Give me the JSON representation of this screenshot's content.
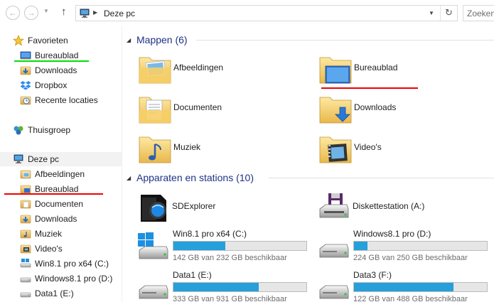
{
  "address": {
    "back_glyph": "←",
    "forward_glyph": "→",
    "up_glyph": "↑",
    "path": "Deze pc",
    "refresh_glyph": "↻",
    "search_placeholder": "Zoeken"
  },
  "nav": {
    "favorites": {
      "label": "Favorieten",
      "items": [
        {
          "label": "Bureaublad",
          "icon": "desktop-icon"
        },
        {
          "label": "Downloads",
          "icon": "downloads-icon"
        },
        {
          "label": "Dropbox",
          "icon": "dropbox-icon"
        },
        {
          "label": "Recente locaties",
          "icon": "recent-icon"
        }
      ]
    },
    "homegroup": {
      "label": "Thuisgroep"
    },
    "thispc": {
      "label": "Deze pc",
      "items": [
        {
          "label": "Afbeeldingen"
        },
        {
          "label": "Bureaublad"
        },
        {
          "label": "Documenten"
        },
        {
          "label": "Downloads"
        },
        {
          "label": "Muziek"
        },
        {
          "label": "Video's"
        },
        {
          "label": "Win8.1 pro x64  (C:)"
        },
        {
          "label": "Windows8.1 pro (D:)"
        },
        {
          "label": "Data1 (E:)"
        }
      ]
    }
  },
  "content": {
    "folders_header": "Mappen (6)",
    "folders": [
      {
        "name": "Afbeeldingen",
        "icon": "pictures-folder-icon"
      },
      {
        "name": "Bureaublad",
        "icon": "desktop-folder-icon"
      },
      {
        "name": "Documenten",
        "icon": "documents-folder-icon"
      },
      {
        "name": "Downloads",
        "icon": "downloads-folder-icon"
      },
      {
        "name": "Muziek",
        "icon": "music-folder-icon"
      },
      {
        "name": "Video's",
        "icon": "videos-folder-icon"
      }
    ],
    "devices_header": "Apparaten en stations (10)",
    "devices": [
      {
        "name": "SDExplorer",
        "icon": "sdexplorer-icon"
      },
      {
        "name": "Diskettestation (A:)",
        "icon": "floppy-drive-icon"
      }
    ],
    "drives": [
      {
        "name": "Win8.1 pro x64  (C:)",
        "free": "142 GB van 232 GB beschikbaar",
        "used_fraction": 0.39,
        "icon": "windows-drive-icon"
      },
      {
        "name": "Windows8.1 pro (D:)",
        "free": "224 GB van 250 GB beschikbaar",
        "used_fraction": 0.1,
        "icon": "hard-drive-icon"
      },
      {
        "name": "Data1 (E:)",
        "free": "333 GB van 931 GB beschikbaar",
        "used_fraction": 0.64,
        "icon": "hard-drive-icon"
      },
      {
        "name": "Data3 (F:)",
        "free": "122 GB van 488 GB beschikbaar",
        "used_fraction": 0.75,
        "icon": "hard-drive-icon"
      }
    ]
  },
  "colors": {
    "accent": "#26a0da",
    "header_text": "#1e3287",
    "highlight_green": "#00e000",
    "highlight_red": "#f00000"
  }
}
